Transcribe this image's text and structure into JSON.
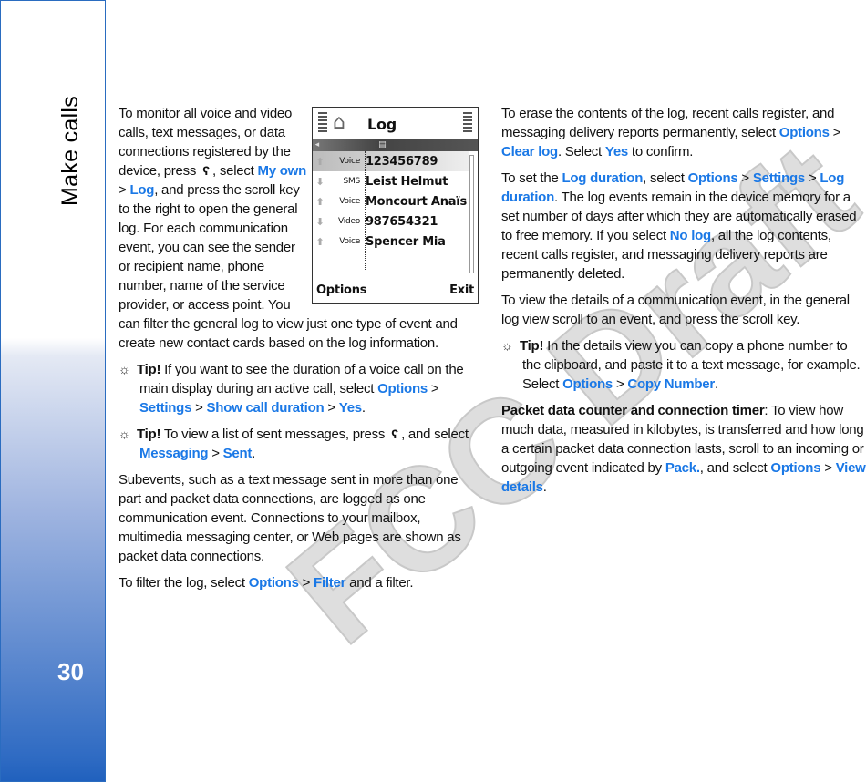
{
  "sidebar": {
    "section_title": "Make calls",
    "page_number": "30"
  },
  "watermark": "FCC Draft",
  "colors": {
    "link": "#1a78e6",
    "sidebar_blue": "#1f60bd"
  },
  "phone_screen": {
    "title": "Log",
    "rows": [
      {
        "direction": "outgoing",
        "type": "Voice",
        "name": "123456789",
        "selected": true
      },
      {
        "direction": "incoming",
        "type": "SMS",
        "name": "Leist Helmut"
      },
      {
        "direction": "outgoing",
        "type": "Voice",
        "name": "Moncourt Anaïs"
      },
      {
        "direction": "incoming",
        "type": "Video",
        "name": "987654321"
      },
      {
        "direction": "outgoing",
        "type": "Voice",
        "name": "Spencer Mia"
      }
    ],
    "left_softkey": "Options",
    "right_softkey": "Exit"
  },
  "left_column": [
    {
      "kind": "p",
      "segments": [
        {
          "s": "text",
          "t": "To monitor all voice and video calls, text messages, or data connections registered by the device, press "
        },
        {
          "s": "key",
          "t": "ʕ"
        },
        {
          "s": "text",
          "t": ", select "
        },
        {
          "s": "link",
          "t": "My own"
        },
        {
          "s": "text",
          "t": " > "
        },
        {
          "s": "link",
          "t": "Log"
        },
        {
          "s": "text",
          "t": ", and press the scroll key to the right to open the general log. For each communication event, you can see the sender or recipient name, phone number, name of the service provider, or access point. You can filter the general log to view just one type of event and create new contact cards based on the log information."
        }
      ]
    },
    {
      "kind": "tip",
      "segments": [
        {
          "s": "bold",
          "t": "Tip!"
        },
        {
          "s": "text",
          "t": " If you want to see the duration of a voice call on the main display during an active call, select "
        },
        {
          "s": "link",
          "t": "Options"
        },
        {
          "s": "text",
          "t": " > "
        },
        {
          "s": "link",
          "t": "Settings"
        },
        {
          "s": "text",
          "t": " > "
        },
        {
          "s": "link",
          "t": "Show call duration"
        },
        {
          "s": "text",
          "t": " > "
        },
        {
          "s": "link",
          "t": "Yes"
        },
        {
          "s": "text",
          "t": "."
        }
      ]
    },
    {
      "kind": "tip",
      "segments": [
        {
          "s": "bold",
          "t": "Tip!"
        },
        {
          "s": "text",
          "t": " To view a list of sent messages, press "
        },
        {
          "s": "key",
          "t": "ʕ"
        },
        {
          "s": "text",
          "t": ", and select "
        },
        {
          "s": "link",
          "t": "Messaging"
        },
        {
          "s": "text",
          "t": " > "
        },
        {
          "s": "link",
          "t": "Sent"
        },
        {
          "s": "text",
          "t": "."
        }
      ]
    },
    {
      "kind": "p",
      "segments": [
        {
          "s": "text",
          "t": "Subevents, such as a text message sent in more than one part and packet data connections, are logged as one communication event. Connections to your mailbox, multimedia messaging center, or Web pages are shown as packet data connections."
        }
      ]
    },
    {
      "kind": "p",
      "segments": [
        {
          "s": "text",
          "t": "To filter the log, select "
        },
        {
          "s": "link",
          "t": "Options"
        },
        {
          "s": "text",
          "t": " > "
        },
        {
          "s": "link",
          "t": "Filter"
        },
        {
          "s": "text",
          "t": " and a filter."
        }
      ]
    }
  ],
  "right_column": [
    {
      "kind": "p",
      "segments": [
        {
          "s": "text",
          "t": "To erase the contents of the log, recent calls register, and messaging delivery reports permanently, select "
        },
        {
          "s": "link",
          "t": "Options"
        },
        {
          "s": "text",
          "t": " > "
        },
        {
          "s": "link",
          "t": "Clear log"
        },
        {
          "s": "text",
          "t": ". Select "
        },
        {
          "s": "link",
          "t": "Yes"
        },
        {
          "s": "text",
          "t": " to confirm."
        }
      ]
    },
    {
      "kind": "p",
      "segments": [
        {
          "s": "text",
          "t": "To set the "
        },
        {
          "s": "link",
          "t": "Log duration"
        },
        {
          "s": "text",
          "t": ", select "
        },
        {
          "s": "link",
          "t": "Options"
        },
        {
          "s": "text",
          "t": " > "
        },
        {
          "s": "link",
          "t": "Settings"
        },
        {
          "s": "text",
          "t": " > "
        },
        {
          "s": "link",
          "t": "Log duration"
        },
        {
          "s": "text",
          "t": ". The log events remain in the device memory for a set number of days after which they are automatically erased to free memory. If you select "
        },
        {
          "s": "link",
          "t": "No log"
        },
        {
          "s": "text",
          "t": ", all the log contents, recent calls register, and messaging delivery reports are permanently deleted."
        }
      ]
    },
    {
      "kind": "p",
      "segments": [
        {
          "s": "text",
          "t": "To view the details of a communication event, in the general log view scroll to an event, and press the scroll key."
        }
      ]
    },
    {
      "kind": "tip",
      "segments": [
        {
          "s": "bold",
          "t": "Tip!"
        },
        {
          "s": "text",
          "t": " In the details view you can copy a phone number to the clipboard, and paste it to a text message, for example. Select "
        },
        {
          "s": "link",
          "t": "Options"
        },
        {
          "s": "text",
          "t": " > "
        },
        {
          "s": "link",
          "t": "Copy Number"
        },
        {
          "s": "text",
          "t": "."
        }
      ]
    },
    {
      "kind": "p",
      "segments": [
        {
          "s": "bold",
          "t": "Packet data counter and connection timer"
        },
        {
          "s": "text",
          "t": ": To view how much data, measured in kilobytes, is transferred and how long a certain packet data connection lasts, scroll to an incoming or outgoing event indicated by "
        },
        {
          "s": "link",
          "t": "Pack."
        },
        {
          "s": "text",
          "t": ", and select "
        },
        {
          "s": "link",
          "t": "Options"
        },
        {
          "s": "text",
          "t": " > "
        },
        {
          "s": "link",
          "t": "View details"
        },
        {
          "s": "text",
          "t": "."
        }
      ]
    }
  ]
}
